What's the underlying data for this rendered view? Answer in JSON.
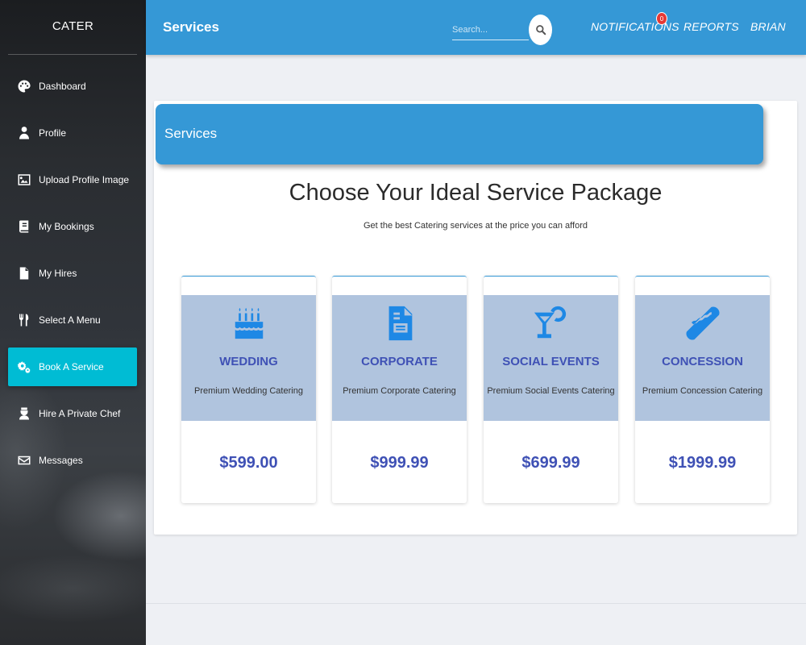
{
  "sidebar": {
    "brand": "CATER",
    "items": [
      {
        "label": "Dashboard",
        "icon": "palette-icon",
        "active": false
      },
      {
        "label": "Profile",
        "icon": "user-icon",
        "active": false
      },
      {
        "label": "Upload Profile Image",
        "icon": "image-icon",
        "active": false
      },
      {
        "label": "My Bookings",
        "icon": "book-icon",
        "active": false
      },
      {
        "label": "My Hires",
        "icon": "file-icon",
        "active": false
      },
      {
        "label": "Select A Menu",
        "icon": "utensils-icon",
        "active": false
      },
      {
        "label": "Book A Service",
        "icon": "cogs-icon",
        "active": true
      },
      {
        "label": "Hire A Private Chef",
        "icon": "chef-icon",
        "active": false
      },
      {
        "label": "Messages",
        "icon": "envelope-icon",
        "active": false
      }
    ]
  },
  "topbar": {
    "title": "Services",
    "search_placeholder": "Search...",
    "notifications_label": "NOTIFICATIONS",
    "notifications_count": "0",
    "reports_label": "REPORTS",
    "user_label": "BRIAN"
  },
  "main": {
    "header_title": "Services",
    "headline": "Choose Your Ideal Service Package",
    "subline": "Get the best Catering services at the price you can afford",
    "packages": [
      {
        "name": "WEDDING",
        "desc": "Premium Wedding Catering",
        "price": "$599.00",
        "icon": "birthday-cake-icon"
      },
      {
        "name": "CORPORATE",
        "desc": "Premium Corporate Catering",
        "price": "$999.99",
        "icon": "document-icon"
      },
      {
        "name": "SOCIAL EVENTS",
        "desc": "Premium Social Events Catering",
        "price": "$699.99",
        "icon": "cocktail-icon"
      },
      {
        "name": "CONCESSION",
        "desc": "Premium Concession Catering",
        "price": "$1999.99",
        "icon": "hotdog-icon"
      }
    ]
  },
  "colors": {
    "sidebar_active": "#00bcd4",
    "topbar": "#3598d6",
    "package_band": "#b0c4de",
    "package_text": "#3f51b5",
    "icon_blue": "#1e88e5"
  }
}
